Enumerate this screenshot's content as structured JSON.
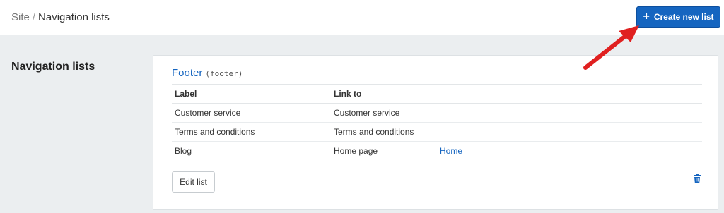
{
  "breadcrumb": {
    "parent": "Site",
    "separator": "/",
    "current": "Navigation lists"
  },
  "header": {
    "create_button_label": "Create new list",
    "create_button_icon": "plus-icon"
  },
  "section": {
    "title": "Navigation lists"
  },
  "card": {
    "name": "Footer",
    "handle": "(footer)",
    "columns": [
      "Label",
      "Link to"
    ],
    "rows": [
      {
        "label": "Customer service",
        "link_to": "Customer service",
        "extra": ""
      },
      {
        "label": "Terms and conditions",
        "link_to": "Terms and conditions",
        "extra": ""
      },
      {
        "label": "Blog",
        "link_to": "Home page",
        "extra": "Home"
      }
    ],
    "edit_label": "Edit list",
    "delete_icon": "trash-icon"
  },
  "colors": {
    "accent": "#1565c0",
    "background": "#ebeef0",
    "annotation_arrow": "#e02020"
  }
}
